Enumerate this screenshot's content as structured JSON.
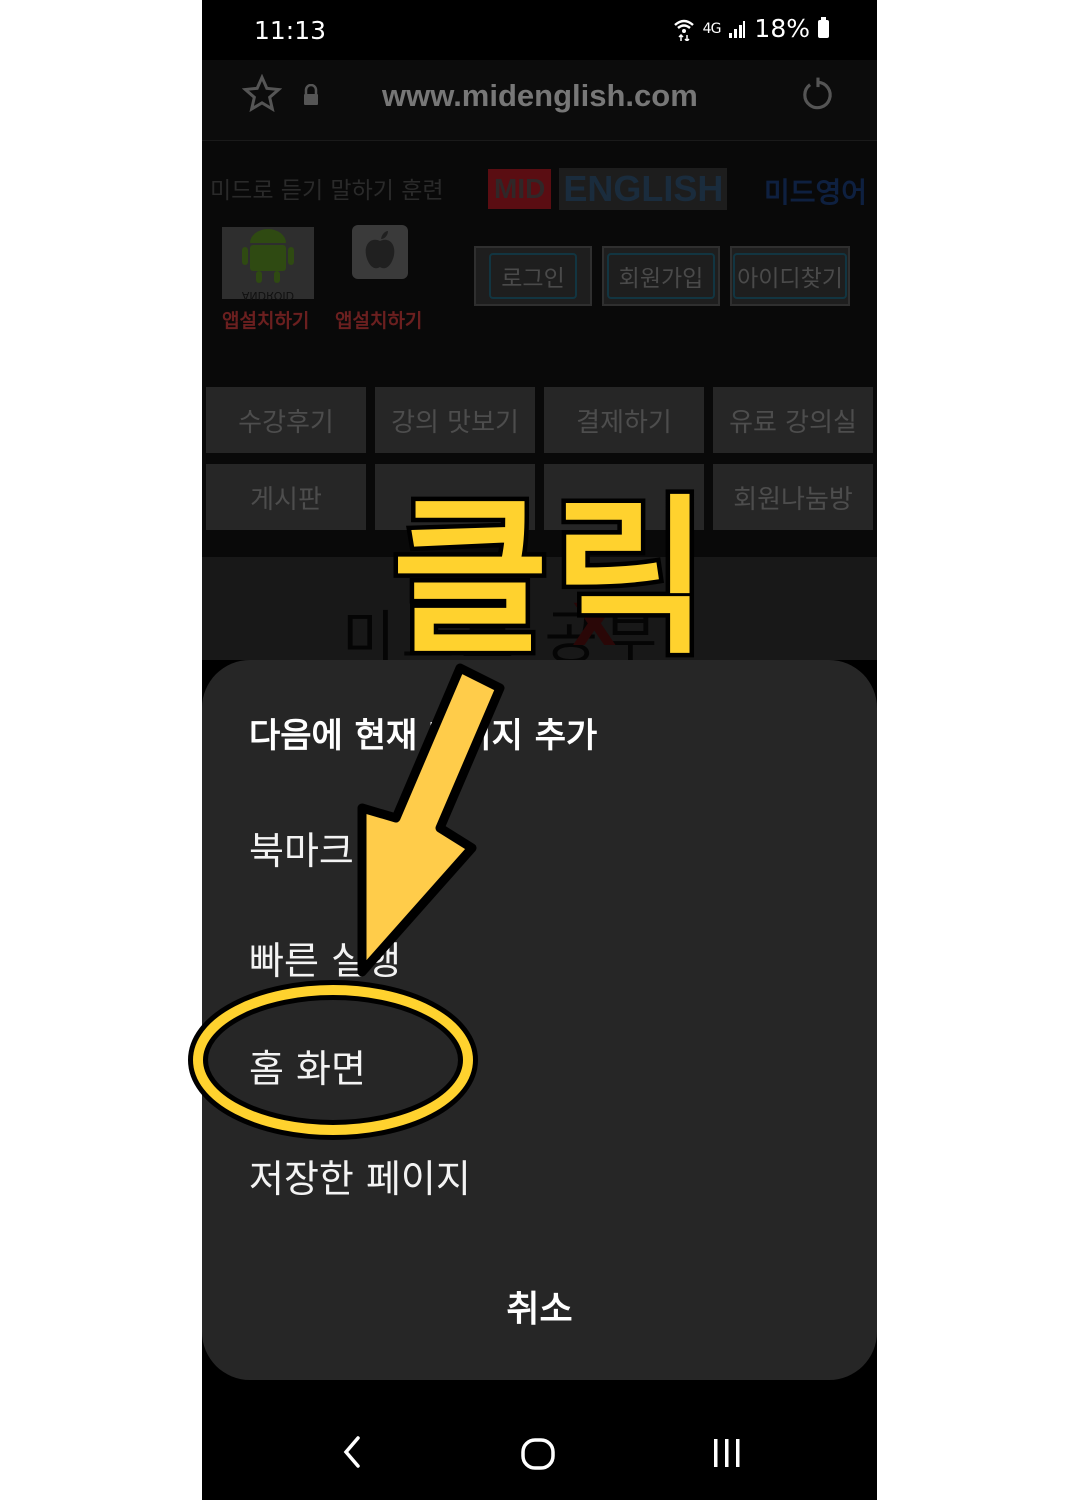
{
  "status_bar": {
    "time": "11:13",
    "network": "4G",
    "battery": "18%"
  },
  "browser": {
    "url": "www.midenglish.com"
  },
  "site": {
    "tagline": "미드로 듣기 말하기 훈련",
    "logo_mid": "MID",
    "logo_english": "ENGLISH",
    "logo_korean": "미드영어",
    "android_label": "앱설치하기",
    "apple_label": "앱설치하기",
    "android_badge": "ANDROID",
    "buttons": [
      "로그인",
      "회원가입",
      "아이디찾기"
    ],
    "nav_row1": [
      "수강후기",
      "강의 맛보기",
      "결제하기",
      "유료 강의실"
    ],
    "nav_row2": [
      "게시판",
      "",
      "",
      "회원나눔방"
    ],
    "heading": "미드로 공부",
    "heading_mark": "X"
  },
  "sheet": {
    "title": "다음에 현재 페이지 추가",
    "items": [
      "북마크",
      "빠른 실행",
      "홈 화면",
      "저장한 페이지"
    ],
    "cancel": "취소"
  },
  "annotation": {
    "text": "클릭",
    "color": "#ffd22e"
  },
  "icons": [
    "star-icon",
    "lock-icon",
    "reload-icon",
    "wifi-icon",
    "signal-icon",
    "battery-icon",
    "back-icon",
    "home-icon",
    "recents-icon",
    "android-icon",
    "apple-icon"
  ]
}
